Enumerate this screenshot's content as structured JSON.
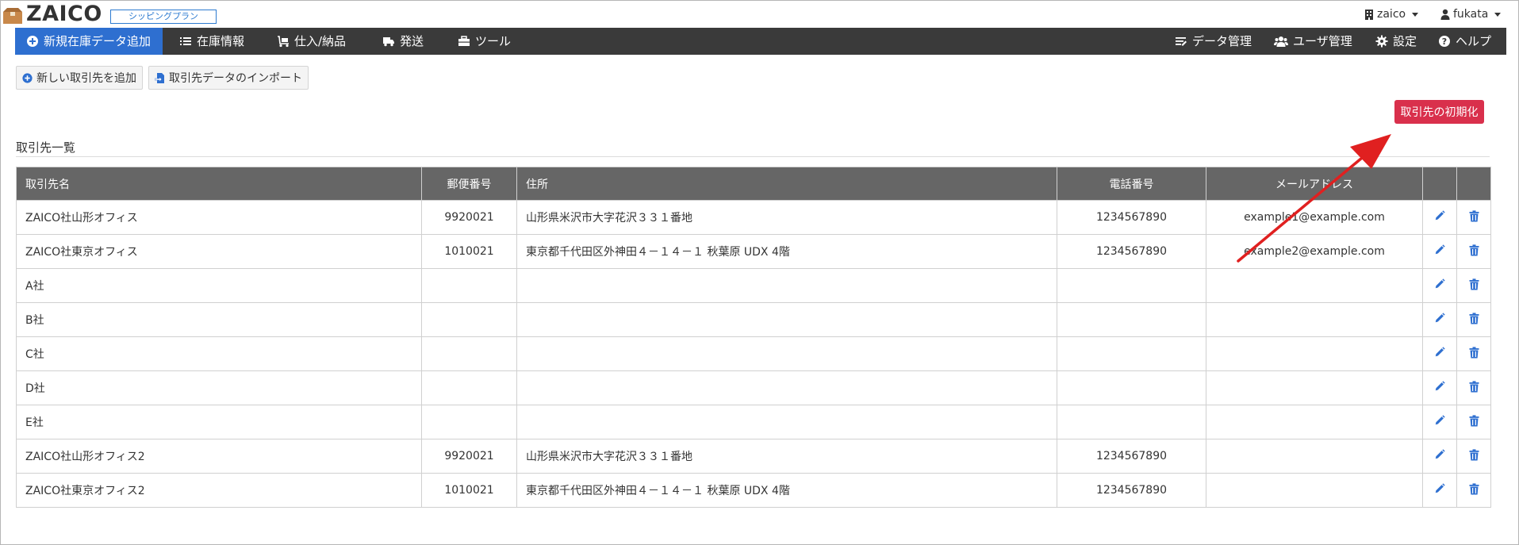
{
  "header": {
    "logo": "ZAICO",
    "plan_badge": "シッピングプラン",
    "company": "zaico",
    "user": "fukata"
  },
  "nav": {
    "left": [
      {
        "label": "新規在庫データ追加",
        "icon": "plus-circle-icon",
        "active": true
      },
      {
        "label": "在庫情報",
        "icon": "list-icon"
      },
      {
        "label": "仕入/納品",
        "icon": "dolly-icon"
      },
      {
        "label": "発送",
        "icon": "truck-icon"
      },
      {
        "label": "ツール",
        "icon": "toolbox-icon"
      }
    ],
    "right": [
      {
        "label": "データ管理",
        "icon": "data-manage-icon"
      },
      {
        "label": "ユーザ管理",
        "icon": "users-icon"
      },
      {
        "label": "設定",
        "icon": "gear-icon"
      },
      {
        "label": "ヘルプ",
        "icon": "question-circle-icon"
      }
    ]
  },
  "actions": {
    "add_label": "新しい取引先を追加",
    "import_label": "取引先データのインポート",
    "reset_label": "取引先の初期化"
  },
  "list": {
    "title": "取引先一覧",
    "columns": [
      "取引先名",
      "郵便番号",
      "住所",
      "電話番号",
      "メールアドレス",
      "",
      ""
    ],
    "rows": [
      {
        "name": "ZAICO社山形オフィス",
        "zip": "9920021",
        "address": "山形県米沢市大字花沢３３１番地",
        "phone": "1234567890",
        "email": "example1@example.com"
      },
      {
        "name": "ZAICO社東京オフィス",
        "zip": "1010021",
        "address": "東京都千代田区外神田４－１４－１ 秋葉原 UDX 4階",
        "phone": "1234567890",
        "email": "example2@example.com"
      },
      {
        "name": "A社",
        "zip": "",
        "address": "",
        "phone": "",
        "email": ""
      },
      {
        "name": "B社",
        "zip": "",
        "address": "",
        "phone": "",
        "email": ""
      },
      {
        "name": "C社",
        "zip": "",
        "address": "",
        "phone": "",
        "email": ""
      },
      {
        "name": "D社",
        "zip": "",
        "address": "",
        "phone": "",
        "email": ""
      },
      {
        "name": "E社",
        "zip": "",
        "address": "",
        "phone": "",
        "email": ""
      },
      {
        "name": "ZAICO社山形オフィス2",
        "zip": "9920021",
        "address": "山形県米沢市大字花沢３３１番地",
        "phone": "1234567890",
        "email": ""
      },
      {
        "name": "ZAICO社東京オフィス2",
        "zip": "1010021",
        "address": "東京都千代田区外神田４－１４－１ 秋葉原 UDX 4階",
        "phone": "1234567890",
        "email": ""
      }
    ]
  },
  "colors": {
    "navbar": "#3a3a3a",
    "active_nav": "#2e6fd0",
    "danger": "#d9304c",
    "header_row": "#666666",
    "icon_blue": "#2e6fd0",
    "arrow": "#e02020"
  }
}
